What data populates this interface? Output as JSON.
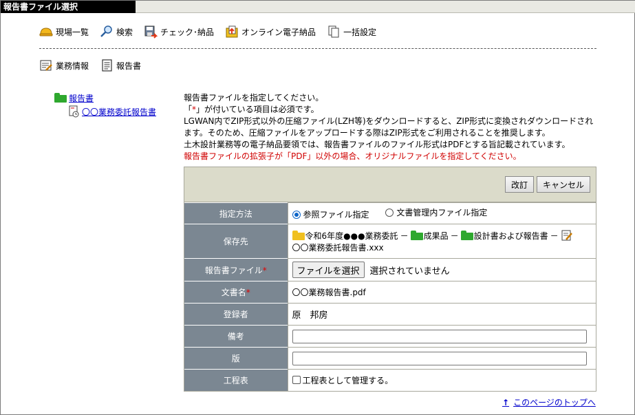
{
  "window": {
    "title": "報告書ファイル選択"
  },
  "toolbar": {
    "items": [
      {
        "label": "現場一覧",
        "icon": "helmet-icon"
      },
      {
        "label": "検索",
        "icon": "magnifier-icon"
      },
      {
        "label": "チェック･納品",
        "icon": "floppy-arrow-icon"
      },
      {
        "label": "オンライン電子納品",
        "icon": "upload-folder-icon"
      },
      {
        "label": "一括設定",
        "icon": "pages-icon"
      }
    ]
  },
  "toolbar2": {
    "items": [
      {
        "label": "業務情報",
        "icon": "edit-form-icon"
      },
      {
        "label": "報告書",
        "icon": "document-icon"
      }
    ]
  },
  "tree": {
    "root": {
      "label": "報告書",
      "icon": "green-folder-icon"
    },
    "child": {
      "label": "〇〇業務委託報告書",
      "icon": "report-doc-icon"
    }
  },
  "instructions": {
    "line1": "報告書ファイルを指定してください。",
    "line2_prefix": "「",
    "line2_star": "*",
    "line2_suffix": "」が付いている項目は必須です。",
    "line3": "LGWAN内でZIP形式以外の圧縮ファイル(LZH等)をダウンロードすると、ZIP形式に変換されダウンロードされます。そのため、圧縮ファイルをアップロードする際はZIP形式をご利用されることを推奨します。",
    "line4": "土木設計業務等の電子納品要領では、報告書ファイルのファイル形式はPDFとする旨記載されています。",
    "line5": "報告書ファイルの拡張子が「PDF」以外の場合、オリジナルファイルを指定してください。"
  },
  "panel": {
    "buttons": {
      "revise": "改訂",
      "cancel": "キャンセル"
    },
    "rows": {
      "method": {
        "label": "指定方法",
        "option1": "参照ファイル指定",
        "option2": "文書管理内ファイル指定",
        "selected": "option1"
      },
      "destination": {
        "label": "保存先",
        "path1": "令和6年度●●●業務委託",
        "path2": "成果品",
        "path3": "設計書および報告書",
        "sep": "－",
        "file": "〇〇業務委託報告書.xxx"
      },
      "report_file": {
        "label": "報告書ファイル",
        "star": "*",
        "button": "ファイルを選択",
        "status": "選択されていません"
      },
      "doc_name": {
        "label": "文書名",
        "star": "*",
        "value": "〇〇業務報告書.pdf"
      },
      "registrant": {
        "label": "登録者",
        "value": "原　邦房"
      },
      "remarks": {
        "label": "備考",
        "value": ""
      },
      "edition": {
        "label": "版",
        "value": ""
      },
      "schedule": {
        "label": "工程表",
        "checkbox_label": "工程表として管理する。",
        "checked": false
      }
    }
  },
  "footer": {
    "top_link": "このページのトップへ",
    "top_link_arrow": "↑"
  },
  "colors": {
    "header_label_bg": "#7b8792",
    "panel_head_bg": "#dbdbca",
    "required": "#d00000",
    "link": "#0000cc",
    "folder_yellow": "#f0c020",
    "folder_green": "#2ea82e"
  }
}
